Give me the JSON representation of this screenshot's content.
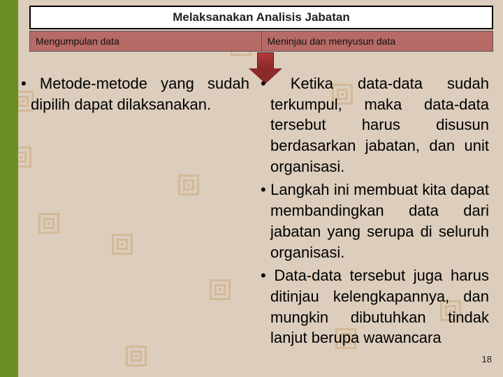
{
  "title": "Melaksanakan Analisis Jabatan",
  "headers": {
    "left": "Mengumpulan data",
    "right": "Meninjau dan menyusun data"
  },
  "left_col": {
    "items": [
      "Metode-metode yang sudah dipilih dapat dilaksanakan."
    ]
  },
  "right_col": {
    "items": [
      "Ketika data-data sudah terkumpul, maka data-data tersebut harus disusun berdasarkan jabatan, dan unit organisasi.",
      "Langkah ini membuat kita dapat membandingkan data dari jabatan yang serupa di seluruh organisasi.",
      "Data-data tersebut juga harus ditinjau kelengkapannya, dan mungkin dibutuhkan tindak lanjut berupa wawancara"
    ]
  },
  "page_number": "18"
}
